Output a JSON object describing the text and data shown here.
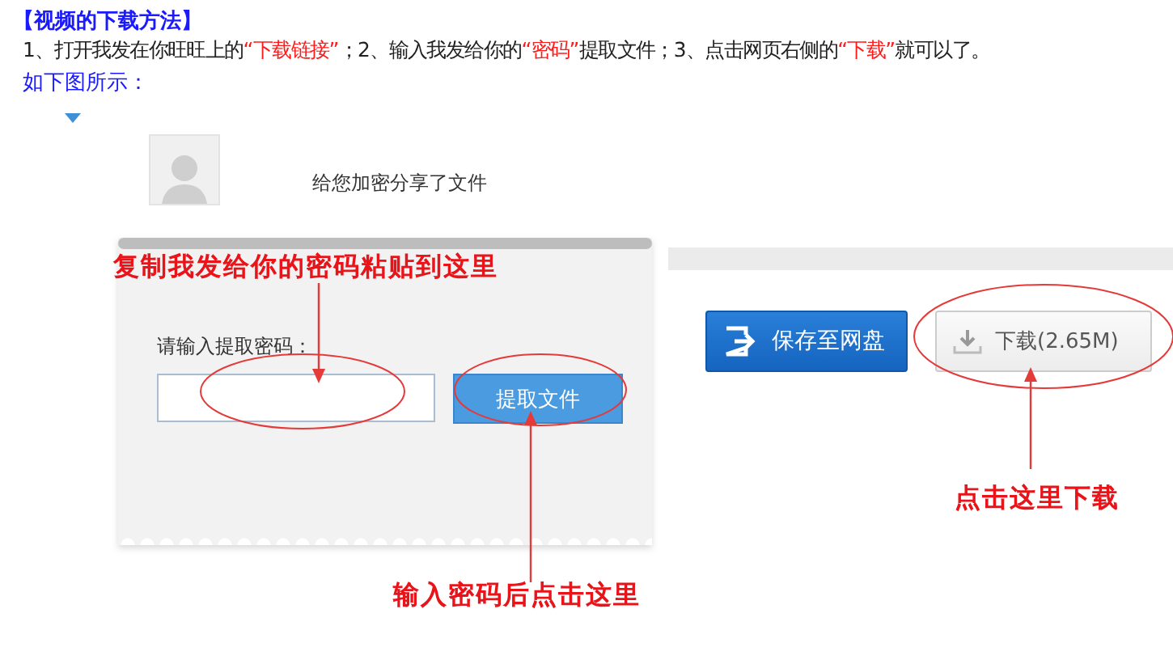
{
  "heading": "【视频的下载方法】",
  "instructions": [
    {
      "text": "1、打开我发在你旺旺上的",
      "highlight": false
    },
    {
      "text": "“下载链接”",
      "highlight": true
    },
    {
      "text": "；2、输入我发给你的",
      "highlight": false
    },
    {
      "text": "“密码”",
      "highlight": true
    },
    {
      "text": "提取文件；3、点击网页右侧的",
      "highlight": false
    },
    {
      "text": "“下载”",
      "highlight": true
    },
    {
      "text": "就可以了。",
      "highlight": false
    }
  ],
  "note": "如下图所示：",
  "figure": {
    "share_text": "给您加密分享了文件",
    "password_label": "请输入提取密码：",
    "extract_button": "提取文件",
    "save_button": "保存至网盘",
    "download_button": "下载(2.65M)",
    "annotations": [
      "复制我发给你的密码粘贴到这里",
      "输入密码后点击这里",
      "点击这里下载"
    ]
  }
}
